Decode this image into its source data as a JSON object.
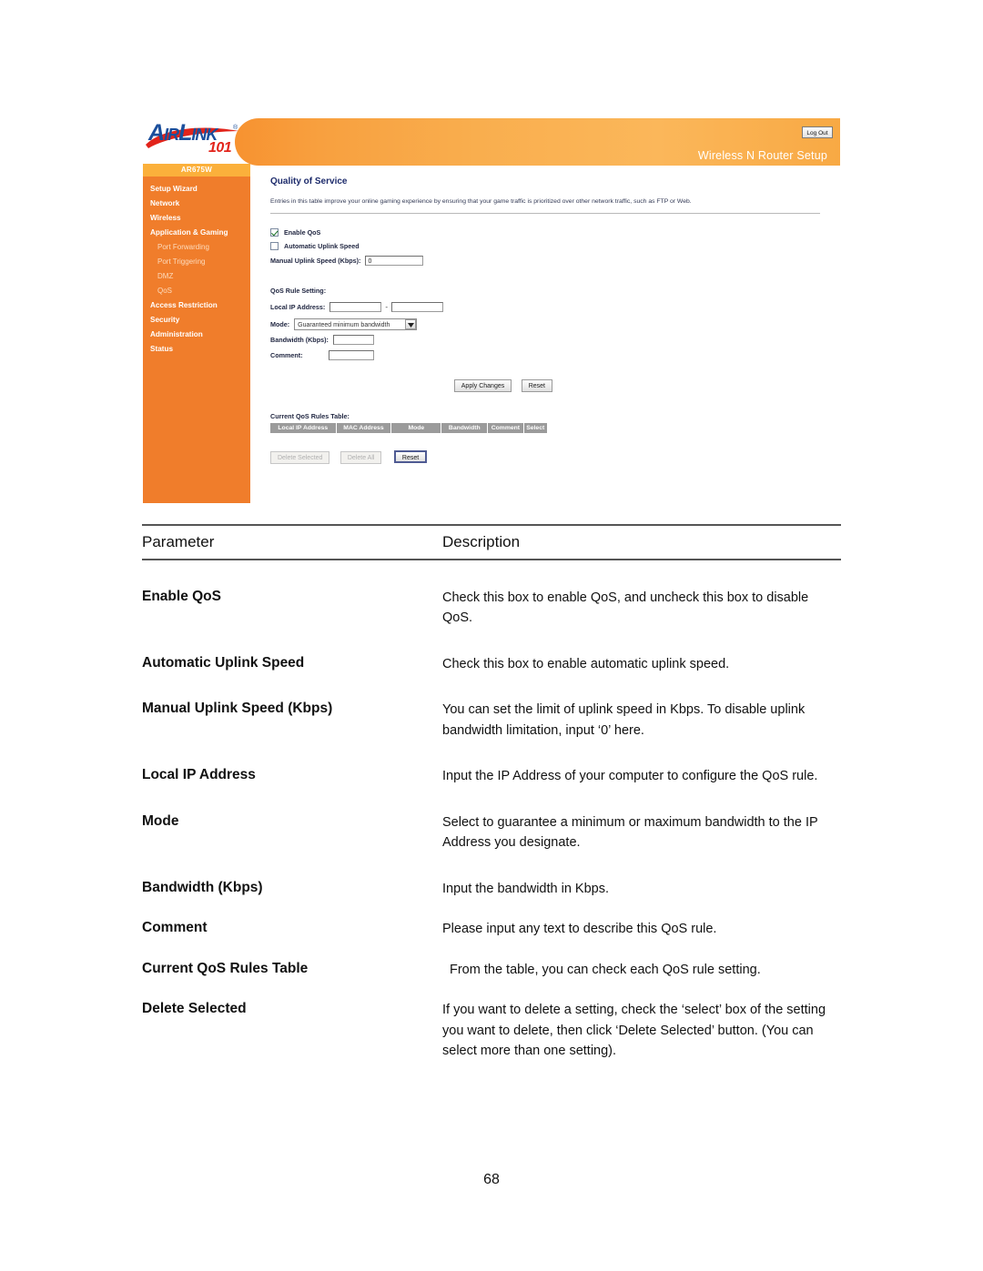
{
  "router_ui": {
    "logo": {
      "brand_main": "IRL",
      "brand_full": "AIRLINK",
      "brand_part_a": "A",
      "brand_part_b": "IR",
      "brand_part_c": "L",
      "brand_part_d": "INK",
      "registered_mark": "®",
      "sub_number": "101",
      "brand_blue": "#1b4f9c",
      "accent_red": "#e2231a"
    },
    "header": {
      "logout_label": "Log Out",
      "title": "Wireless N Router Setup",
      "bar_color": "#f7a03a"
    },
    "sidebar": {
      "model": "AR675W",
      "bg_color": "#f07d2b",
      "model_tab_color": "#fbb03b",
      "items": [
        {
          "label": "Setup Wizard",
          "sub": false
        },
        {
          "label": "Network",
          "sub": false
        },
        {
          "label": "Wireless",
          "sub": false
        },
        {
          "label": "Application & Gaming",
          "sub": false
        },
        {
          "label": "Port Forwarding",
          "sub": true
        },
        {
          "label": "Port Triggering",
          "sub": true
        },
        {
          "label": "DMZ",
          "sub": true
        },
        {
          "label": "QoS",
          "sub": true
        },
        {
          "label": "Access Restriction",
          "sub": false
        },
        {
          "label": "Security",
          "sub": false
        },
        {
          "label": "Administration",
          "sub": false
        },
        {
          "label": "Status",
          "sub": false
        }
      ]
    },
    "content": {
      "page_title": "Quality of Service",
      "description": "Entries in this table improve your online gaming experience by ensuring that your game traffic is prioritized over other network traffic, such as FTP or Web.",
      "enable_qos_label": "Enable QoS",
      "enable_qos_checked": true,
      "auto_uplink_label": "Automatic Uplink Speed",
      "auto_uplink_checked": false,
      "manual_uplink_label": "Manual Uplink Speed (Kbps):",
      "manual_uplink_value": "0",
      "rule_setting_label": "QoS Rule Setting:",
      "local_ip_label": "Local IP Address:",
      "local_ip_start": "",
      "local_ip_end": "",
      "local_ip_separator": "-",
      "mode_label": "Mode:",
      "mode_value": "Guaranteed minimum bandwidth",
      "bandwidth_label": "Bandwidth (Kbps):",
      "bandwidth_value": "",
      "comment_label": "Comment:",
      "comment_value": "",
      "apply_label": "Apply Changes",
      "reset_label": "Reset",
      "rules_table_label": "Current QoS Rules Table:",
      "rules_table_columns": [
        "Local IP Address",
        "MAC Address",
        "Mode",
        "Bandwidth",
        "Comment",
        "Select"
      ],
      "delete_selected_label": "Delete Selected",
      "delete_all_label": "Delete All",
      "bottom_reset_label": "Reset"
    }
  },
  "doc_table": {
    "header": {
      "parameter": "Parameter",
      "description": "Description"
    },
    "rows": [
      {
        "name": "Enable QoS",
        "desc": "Check this box to enable QoS, and uncheck this box to disable QoS."
      },
      {
        "name": "Automatic Uplink Speed",
        "desc": "Check this box to enable automatic uplink speed."
      },
      {
        "name": "Manual Uplink Speed (Kbps)",
        "desc": "You can set the limit of uplink speed in Kbps. To disable uplink bandwidth limitation, input ‘0’ here."
      },
      {
        "name": "Local IP Address",
        "desc": "Input the IP Address of your computer to configure the QoS rule."
      },
      {
        "name": "Mode",
        "desc": "Select to guarantee a minimum or maximum bandwidth to the IP Address you designate."
      },
      {
        "name": "Bandwidth (Kbps)",
        "desc": "Input the bandwidth in Kbps."
      },
      {
        "name": "Comment",
        "desc": "Please input any text to describe this QoS rule."
      },
      {
        "name": "Current QoS Rules Table",
        "desc": "From the table, you can check each QoS rule setting."
      },
      {
        "name": "Delete Selected",
        "desc": "If you want to delete a setting, check the ‘select’ box of the setting you want to delete, then click ‘Delete Selected’ button. (You can select more than one setting)."
      }
    ]
  },
  "page_number": "68"
}
